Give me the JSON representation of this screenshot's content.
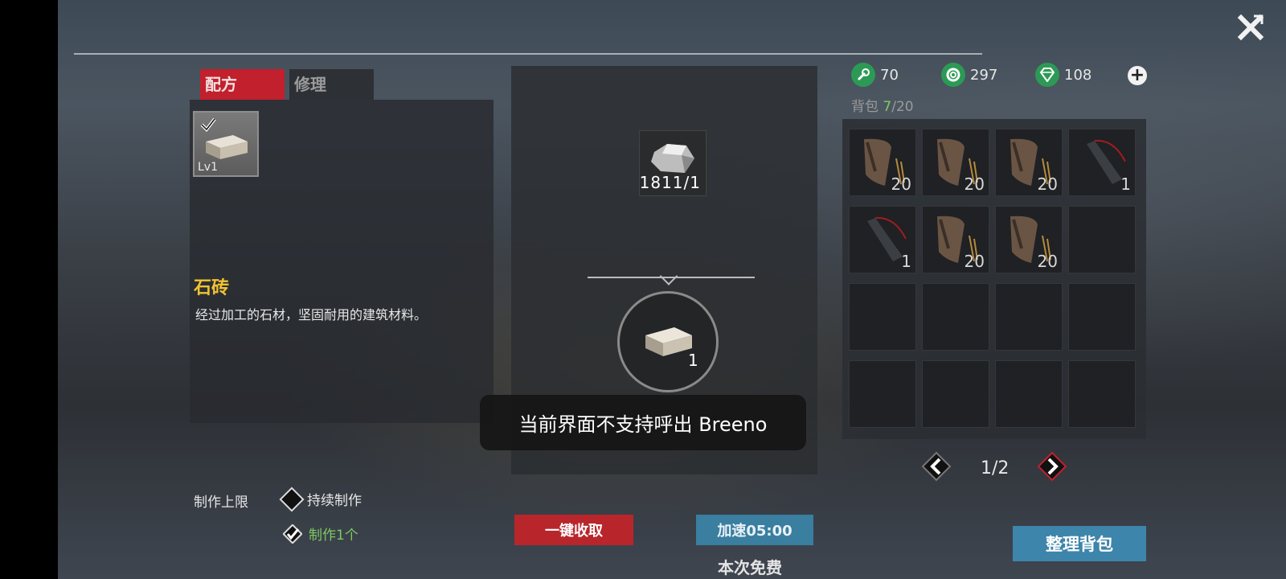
{
  "tabs": {
    "recipe": "配方",
    "repair": "修理"
  },
  "recipe": {
    "level": "Lv1",
    "selected": true
  },
  "item": {
    "name": "石砖",
    "description": "经过加工的石材，坚固耐用的建筑材料。"
  },
  "crafting": {
    "limit_label": "制作上限",
    "option_continuous": "持续制作",
    "option_single": "制作1个",
    "material_count": "1811/1",
    "output_count": "1"
  },
  "toast": "当前界面不支持呼出 Breeno",
  "buttons": {
    "collect_all": "一键收取",
    "speed_up": "加速05:00",
    "free_note": "本次免费",
    "sort_bag": "整理背包"
  },
  "currencies": [
    {
      "icon": "wrench-coin-icon",
      "value": "70"
    },
    {
      "icon": "gear-coin-icon",
      "value": "297"
    },
    {
      "icon": "gem-icon",
      "value": "108"
    }
  ],
  "bag": {
    "label": "背包",
    "used": "7",
    "capacity": "/20"
  },
  "inventory": [
    {
      "item": "magazine",
      "count": "20"
    },
    {
      "item": "magazine",
      "count": "20"
    },
    {
      "item": "magazine",
      "count": "20"
    },
    {
      "item": "bullet",
      "count": "1"
    },
    {
      "item": "bullet",
      "count": "1"
    },
    {
      "item": "magazine",
      "count": "20"
    },
    {
      "item": "magazine",
      "count": "20"
    },
    {
      "item": "",
      "count": ""
    },
    {
      "item": "",
      "count": ""
    },
    {
      "item": "",
      "count": ""
    },
    {
      "item": "",
      "count": ""
    },
    {
      "item": "",
      "count": ""
    },
    {
      "item": "",
      "count": ""
    },
    {
      "item": "",
      "count": ""
    },
    {
      "item": "",
      "count": ""
    },
    {
      "item": "",
      "count": ""
    }
  ],
  "pagination": {
    "label": "1/2"
  },
  "colors": {
    "accent_red": "#c2202d",
    "accent_blue": "#3d85aa",
    "title_gold": "#f0c233",
    "active_green": "#7ec964"
  }
}
